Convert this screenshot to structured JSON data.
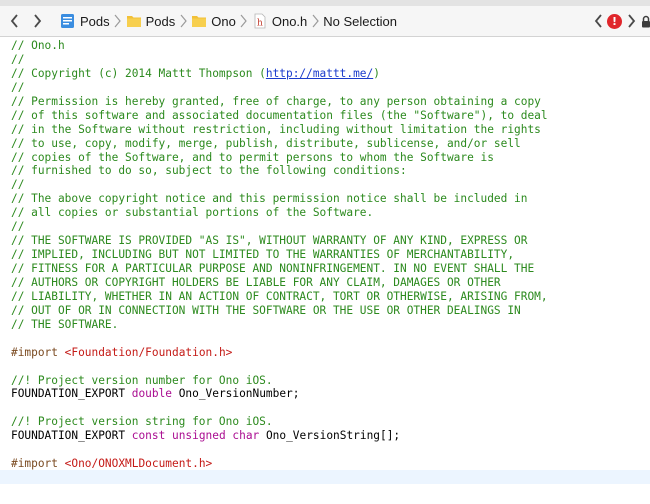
{
  "jumpbar": {
    "crumbs": [
      {
        "label": "Pods",
        "icon": "project-icon"
      },
      {
        "label": "Pods",
        "icon": "folder-icon"
      },
      {
        "label": "Ono",
        "icon": "folder-icon"
      },
      {
        "label": "Ono.h",
        "icon": "header-file-icon"
      },
      {
        "label": "No Selection"
      }
    ],
    "error_badge": "!",
    "colors": {
      "folder": "#f2c038",
      "error": "#e0262b",
      "project": "#3a8de0"
    }
  },
  "editor": {
    "header_comment": [
      {
        "text": "// Ono.h"
      },
      {
        "text": "//"
      },
      {
        "text": "// Copyright (c) 2014 Mattt Thompson (",
        "link": "http://mattt.me/",
        "after": ")"
      },
      {
        "text": "//"
      },
      {
        "text": "// Permission is hereby granted, free of charge, to any person obtaining a copy"
      },
      {
        "text": "// of this software and associated documentation files (the \"Software\"), to deal"
      },
      {
        "text": "// in the Software without restriction, including without limitation the rights"
      },
      {
        "text": "// to use, copy, modify, merge, publish, distribute, sublicense, and/or sell"
      },
      {
        "text": "// copies of the Software, and to permit persons to whom the Software is"
      },
      {
        "text": "// furnished to do so, subject to the following conditions:"
      },
      {
        "text": "//"
      },
      {
        "text": "// The above copyright notice and this permission notice shall be included in"
      },
      {
        "text": "// all copies or substantial portions of the Software."
      },
      {
        "text": "//"
      },
      {
        "text": "// THE SOFTWARE IS PROVIDED \"AS IS\", WITHOUT WARRANTY OF ANY KIND, EXPRESS OR"
      },
      {
        "text": "// IMPLIED, INCLUDING BUT NOT LIMITED TO THE WARRANTIES OF MERCHANTABILITY,"
      },
      {
        "text": "// FITNESS FOR A PARTICULAR PURPOSE AND NONINFRINGEMENT. IN NO EVENT SHALL THE"
      },
      {
        "text": "// AUTHORS OR COPYRIGHT HOLDERS BE LIABLE FOR ANY CLAIM, DAMAGES OR OTHER"
      },
      {
        "text": "// LIABILITY, WHETHER IN AN ACTION OF CONTRACT, TORT OR OTHERWISE, ARISING FROM,"
      },
      {
        "text": "// OUT OF OR IN CONNECTION WITH THE SOFTWARE OR THE USE OR OTHER DEALINGS IN"
      },
      {
        "text": "// THE SOFTWARE."
      }
    ],
    "import1": {
      "directive": "#import",
      "path": "<Foundation/Foundation.h>"
    },
    "comment_version_number": "//! Project version number for Ono iOS.",
    "decl_version_number": {
      "macro": "FOUNDATION_EXPORT",
      "type": "double",
      "name": "Ono_VersionNumber;"
    },
    "comment_version_string": "//! Project version string for Ono iOS.",
    "decl_version_string": {
      "macro": "FOUNDATION_EXPORT",
      "kw1": "const",
      "kw2": "unsigned",
      "kw3": "char",
      "name": "Ono_VersionString[];"
    },
    "import2": {
      "directive": "#import",
      "path": "<Ono/ONOXMLDocument.h>"
    }
  }
}
